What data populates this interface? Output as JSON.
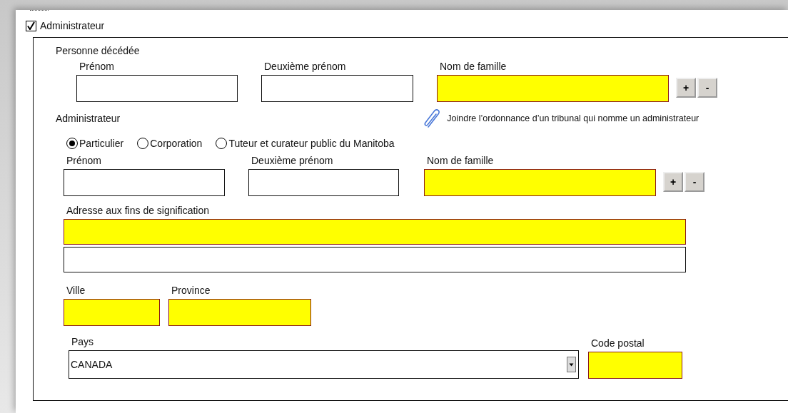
{
  "admin_checkbox": {
    "label": "Administrateur",
    "checked": true
  },
  "deceased": {
    "title": "Personne décédée",
    "fields": [
      {
        "label": "Prénom",
        "required": false
      },
      {
        "label": "Deuxième prénom",
        "required": false
      },
      {
        "label": "Nom de famille",
        "required": true
      }
    ],
    "buttons": [
      "+",
      "-"
    ]
  },
  "administrator": {
    "title": "Administrateur",
    "attachment": "Joindre l’ordonnance d’un tribunal qui nomme un administrateur",
    "radios": [
      {
        "label": "Particulier",
        "selected": true
      },
      {
        "label": "Corporation",
        "selected": false
      },
      {
        "label": "Tuteur et curateur public du Manitoba",
        "selected": false
      }
    ],
    "fields": [
      {
        "label": "Prénom",
        "required": false
      },
      {
        "label": "Deuxième prénom",
        "required": false
      },
      {
        "label": "Nom de famille",
        "required": true
      }
    ],
    "buttons": [
      "+",
      "-"
    ]
  },
  "address": {
    "label": "Adresse aux fins de signification",
    "lines": [
      {
        "required": true
      },
      {
        "required": false
      }
    ]
  },
  "city": {
    "label": "Ville",
    "required": true
  },
  "province": {
    "label": "Province",
    "required": true
  },
  "country": {
    "label": "Pays",
    "value": "CANADA"
  },
  "postal_code": {
    "label": "Code postal",
    "required": true
  }
}
